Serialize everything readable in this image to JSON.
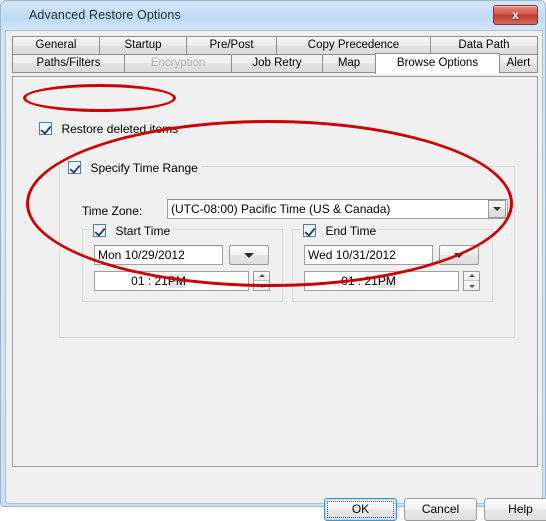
{
  "window": {
    "title": "Advanced Restore Options",
    "close_label": "x",
    "close_icon": "close-icon"
  },
  "tabs": {
    "row1": [
      {
        "label": "General",
        "active": false,
        "disabled": false
      },
      {
        "label": "Startup",
        "active": false,
        "disabled": false
      },
      {
        "label": "Pre/Post",
        "active": false,
        "disabled": false
      },
      {
        "label": "Copy Precedence",
        "active": false,
        "disabled": false
      },
      {
        "label": "Data Path",
        "active": false,
        "disabled": false
      }
    ],
    "row2": [
      {
        "label": "Paths/Filters",
        "active": false,
        "disabled": false
      },
      {
        "label": "Encryption",
        "active": false,
        "disabled": true
      },
      {
        "label": "Job Retry",
        "active": false,
        "disabled": false
      },
      {
        "label": "Map",
        "active": false,
        "disabled": false
      },
      {
        "label": "Browse Options",
        "active": true,
        "disabled": false
      },
      {
        "label": "Alert",
        "active": false,
        "disabled": false
      }
    ]
  },
  "panel": {
    "restore_deleted": {
      "label": "Restore deleted items",
      "checked": true
    },
    "time_range_group": {
      "label": "Specify Time Range",
      "checked": true,
      "timezone_label": "Time Zone:",
      "timezone_value": "(UTC-08:00) Pacific Time (US & Canada)",
      "start": {
        "label": "Start Time",
        "checked": true,
        "date": "Mon 10/29/2012",
        "time_main": "01 : 21",
        "time_meridiem": "PM",
        "dropdown_icon": "chevron-down-icon",
        "spinner_icon": "spinner-up-down-icon"
      },
      "end": {
        "label": "End Time",
        "checked": true,
        "date": "Wed 10/31/2012",
        "time_main": "01 : 21",
        "time_meridiem": "PM",
        "dropdown_icon": "chevron-down-icon",
        "spinner_icon": "spinner-up-down-icon"
      }
    }
  },
  "footer": {
    "ok": "OK",
    "cancel": "Cancel",
    "help": "Help"
  },
  "annotations": {
    "accent_color": "#cc0000",
    "shapes": [
      {
        "name": "restore-deleted-items-highlight"
      },
      {
        "name": "specify-time-range-highlight"
      }
    ]
  }
}
